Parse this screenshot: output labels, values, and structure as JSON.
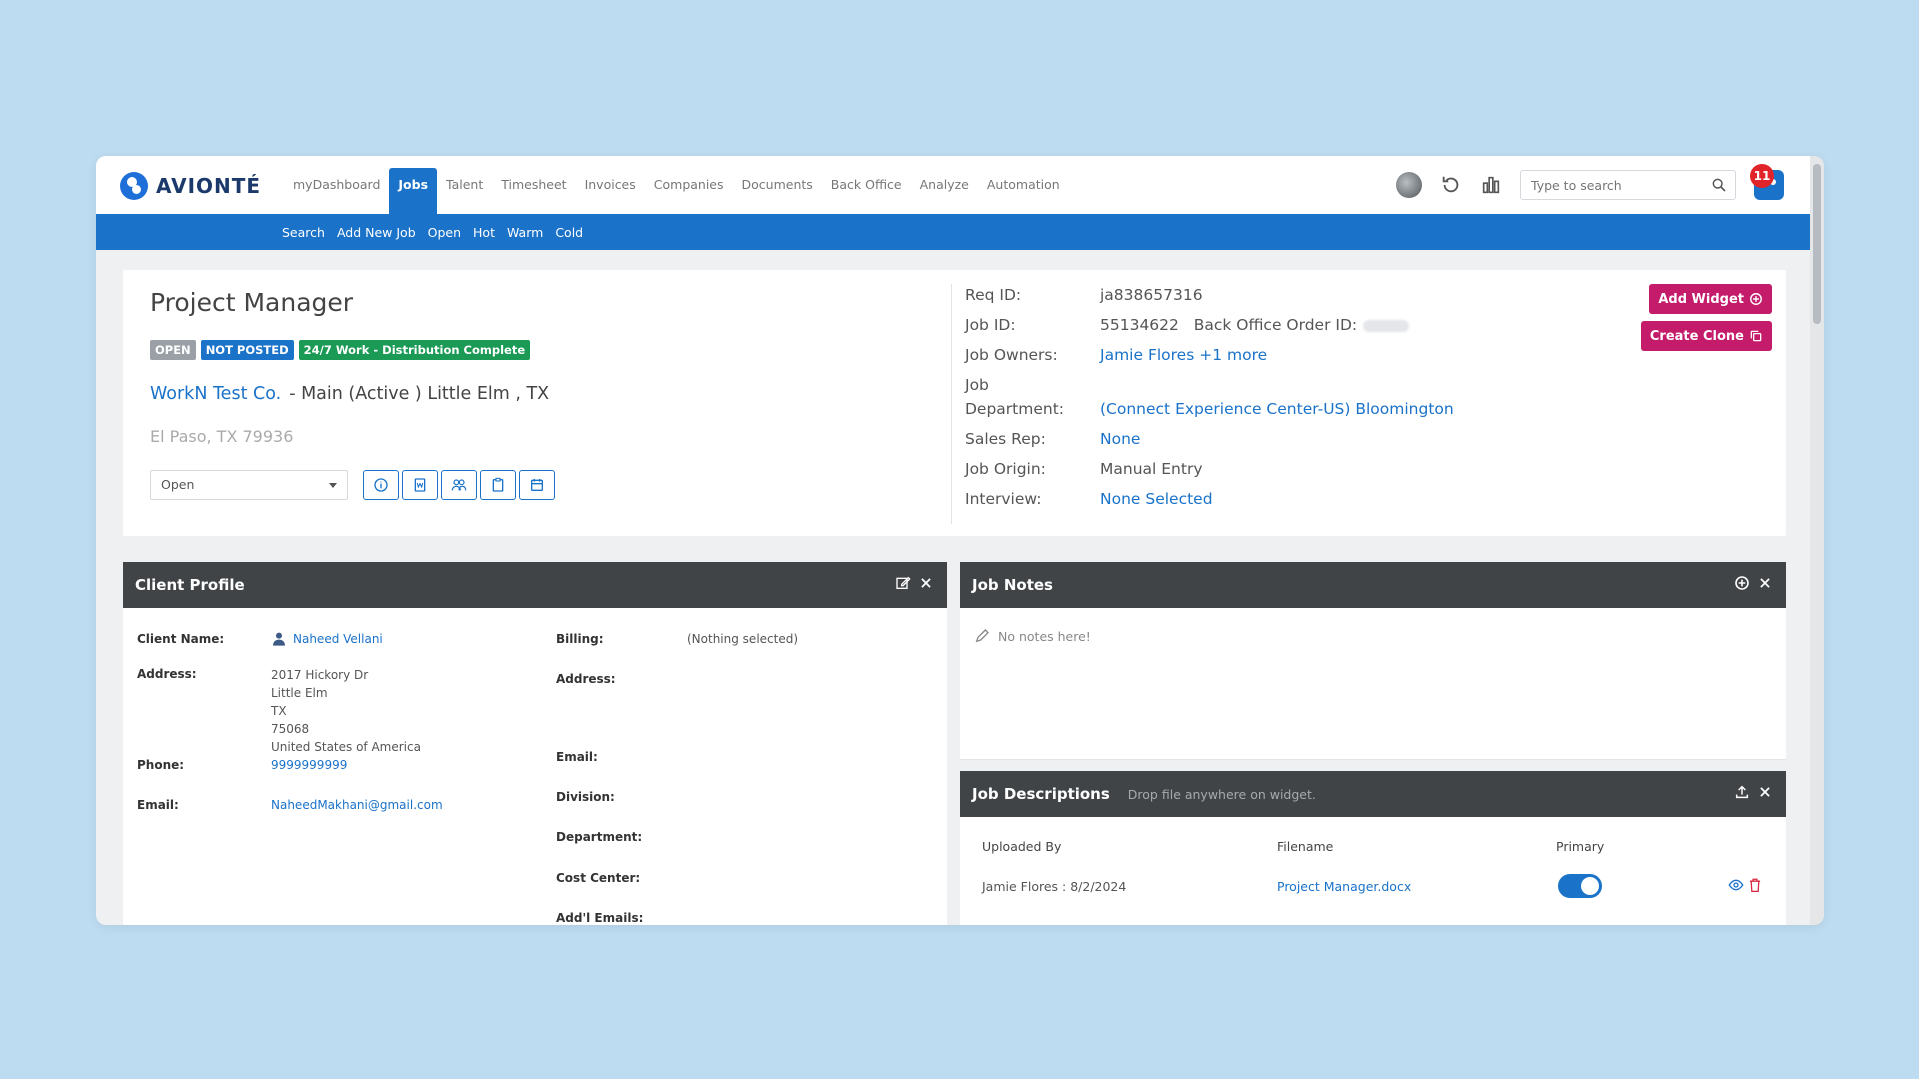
{
  "brand": {
    "name": "AVIONTÉ"
  },
  "nav": {
    "items": [
      "myDashboard",
      "Jobs",
      "Talent",
      "Timesheet",
      "Invoices",
      "Companies",
      "Documents",
      "Back Office",
      "Analyze",
      "Automation"
    ],
    "active": "Jobs",
    "search_placeholder": "Type to search",
    "notification_count": "11"
  },
  "subnav": {
    "items": [
      "Search",
      "Add New Job",
      "Open",
      "Hot",
      "Warm",
      "Cold"
    ]
  },
  "job": {
    "title": "Project Manager",
    "badges": {
      "open": "OPEN",
      "not_posted": "NOT POSTED",
      "distribution": "24/7 Work - Distribution Complete"
    },
    "company_link": "WorkN Test Co.",
    "company_rest": "- Main (Active ) Little Elm , TX",
    "city": "El Paso, TX 79936",
    "status": "Open"
  },
  "fields": {
    "req_id": {
      "label": "Req ID:",
      "value": "ja838657316"
    },
    "job_id": {
      "label": "Job ID:",
      "value": "55134622"
    },
    "back_office_label": "Back Office Order ID:",
    "job_owners": {
      "label": "Job Owners:",
      "value": "Jamie Flores +1 more"
    },
    "job_department": {
      "label_1": "Job",
      "label_2": "Department:",
      "value": "(Connect Experience Center-US) Bloomington"
    },
    "sales_rep": {
      "label": "Sales Rep:",
      "value": "None"
    },
    "job_origin": {
      "label": "Job Origin:",
      "value": "Manual Entry"
    },
    "interview": {
      "label": "Interview:",
      "value": "None Selected"
    }
  },
  "actions": {
    "add_widget": "Add Widget",
    "create_clone": "Create Clone"
  },
  "client_profile": {
    "title": "Client Profile",
    "client_name_label": "Client Name:",
    "client_name": "Naheed Vellani",
    "address_label": "Address:",
    "address_lines": [
      "2017 Hickory Dr",
      "Little Elm",
      "TX",
      "75068",
      "United States of America"
    ],
    "phone_label": "Phone:",
    "phone": "9999999999",
    "email_label": "Email:",
    "email": "NaheedMakhani@gmail.com",
    "billing_label": "Billing:",
    "billing_value": "(Nothing selected)",
    "billing_address_label": "Address:",
    "billing_email_label": "Email:",
    "division_label": "Division:",
    "department_label": "Department:",
    "cost_center_label": "Cost Center:",
    "addl_emails_label": "Add'l Emails:"
  },
  "job_notes": {
    "title": "Job Notes",
    "empty": "No notes here!"
  },
  "job_descriptions": {
    "title": "Job Descriptions",
    "hint": "Drop file anywhere on widget.",
    "columns": [
      "Uploaded By",
      "Filename",
      "Primary"
    ],
    "row": {
      "uploaded_by": "Jamie Flores : 8/2/2024",
      "filename": "Project Manager.docx",
      "primary": true
    }
  }
}
